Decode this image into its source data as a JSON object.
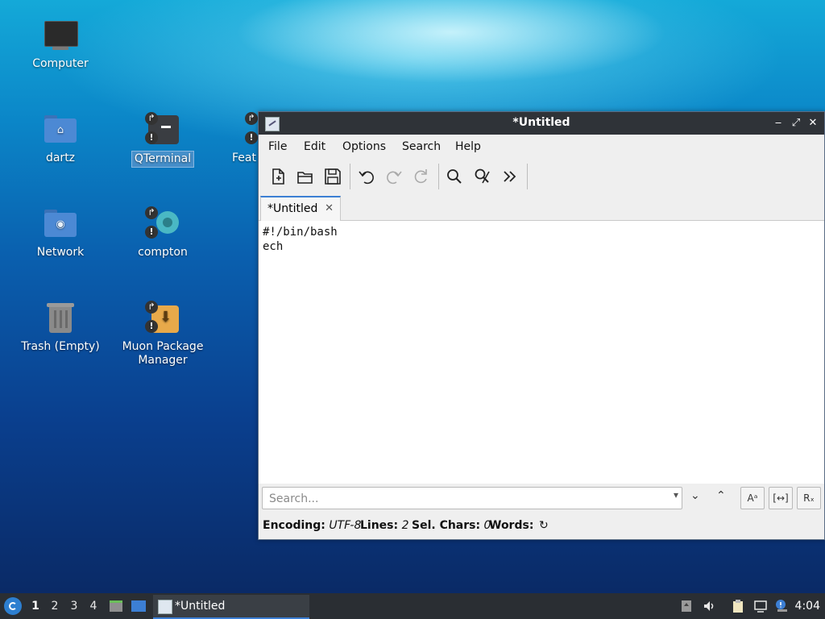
{
  "desktop": {
    "icons": {
      "computer": "Computer",
      "dartz": "dartz",
      "qterminal": "QTerminal",
      "featherpad_partial": "Feat",
      "network": "Network",
      "compton": "compton",
      "trash": "Trash (Empty)",
      "muon": "Muon Package Manager"
    }
  },
  "window": {
    "title": "*Untitled",
    "controls": {
      "minimize": "‒",
      "maximize": "⤢",
      "close": "✕"
    },
    "menu": {
      "file": "File",
      "edit": "Edit",
      "options": "Options",
      "search": "Search",
      "help": "Help"
    },
    "tab": {
      "label": "*Untitled",
      "close": "✕"
    },
    "editor": {
      "lines": [
        "#!/bin/bash",
        "ech"
      ]
    },
    "search": {
      "placeholder": "Search...",
      "dropdown": "▾",
      "next": "⌄",
      "prev": "⌃",
      "match_case": "Aᵃ",
      "whole_word": "[↔]",
      "regex": "Rₓ"
    },
    "status": {
      "encoding_label": "Encoding:",
      "encoding_value": "UTF-8",
      "lines_label": "Lines:",
      "lines_value": "2",
      "sel_label": "Sel. Chars:",
      "sel_value": "0",
      "words_label": "Words:",
      "refresh": "↻"
    }
  },
  "taskbar": {
    "workspaces": [
      "1",
      "2",
      "3",
      "4"
    ],
    "task_label": "*Untitled",
    "clock": "4:04"
  },
  "colors": {
    "accent": "#3c7fd4",
    "titlebar": "#2f3338",
    "taskbar": "#2a2e33"
  }
}
